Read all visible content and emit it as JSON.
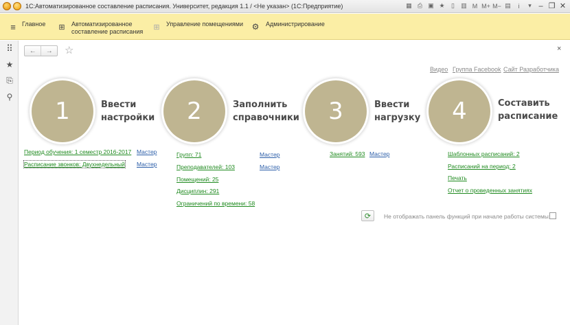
{
  "window": {
    "title": "1С:Автоматизированное составление расписания. Университет, редакция 1.1 / <Не указан>  (1С:Предприятие)",
    "title_icons": [
      "grid-icon",
      "printer-icon",
      "save-icon",
      "star-icon",
      "bookmark-icon",
      "calendar-icon",
      "m-icon",
      "m-plus-icon",
      "m-minus-icon",
      "panels-icon",
      "info-icon",
      "chevron-down-icon",
      "minimize-icon",
      "restore-icon",
      "close-icon"
    ],
    "title_glyphs": [
      "▦",
      "⎙",
      "▣",
      "★",
      "▯",
      "▥",
      "M",
      "M+",
      "M−",
      "▤",
      "i",
      "▾",
      "–",
      "❐",
      "✕"
    ]
  },
  "menu": {
    "items": [
      {
        "label_line1": "Главное",
        "label_line2": "",
        "icon": "hamburger-icon",
        "glyph": "≡"
      },
      {
        "label_line1": "Автоматизированное",
        "label_line2": "составление расписания",
        "icon": "grid-icon",
        "glyph": "⊞"
      },
      {
        "label_line1": "Управление помещениями",
        "label_line2": "",
        "icon": "grid-icon",
        "glyph": "⊞"
      },
      {
        "label_line1": "Администрирование",
        "label_line2": "",
        "icon": "gear-icon",
        "glyph": "⚙"
      }
    ]
  },
  "sidebar": {
    "items": [
      {
        "icon": "apps-grid-icon",
        "glyph": "⠿"
      },
      {
        "icon": "star-icon",
        "glyph": "★"
      },
      {
        "icon": "history-icon",
        "glyph": "⎘"
      },
      {
        "icon": "search-icon",
        "glyph": "⚲"
      }
    ]
  },
  "nav": {
    "back": "←",
    "forward": "→",
    "favorite": "☆",
    "close": "×"
  },
  "top_links": [
    "Видео",
    "Группа Facebook",
    "Сайт Разработчика"
  ],
  "steps": [
    {
      "number": "1",
      "title_line1": "Ввести",
      "title_line2": "настройки",
      "links": [
        {
          "text": "Период обучения: 1 семестр 2016-2017",
          "master": "Мастер"
        },
        {
          "text": "Расписание звонков: Двухнедельный",
          "master": "Мастер"
        }
      ]
    },
    {
      "number": "2",
      "title_line1": "Заполнить",
      "title_line2": "справочники",
      "links": [
        {
          "text": "Групп: 71",
          "master": "Мастер"
        },
        {
          "text": "Преподавателей: 103",
          "master": "Мастер"
        },
        {
          "text": "Помещений: 25",
          "master": ""
        },
        {
          "text": "Дисциплин: 291",
          "master": ""
        },
        {
          "text": "Ограничений по времени: 58",
          "master": ""
        }
      ]
    },
    {
      "number": "3",
      "title_line1": "Ввести",
      "title_line2": "нагрузку",
      "links": [
        {
          "text": "Занятий: 593",
          "master": "Мастер"
        }
      ]
    },
    {
      "number": "4",
      "title_line1": "Составить",
      "title_line2": "расписание",
      "links": [
        {
          "text": "Шаблонных расписаний: 2",
          "master": ""
        },
        {
          "text": "Расписаний на период: 2",
          "master": ""
        },
        {
          "text": "Печать",
          "master": ""
        },
        {
          "text": "Отчет о проведенных занятиях",
          "master": ""
        }
      ]
    }
  ],
  "footer": {
    "option_label": "Не отображать панель функций при начале работы системы:",
    "option_checked": false,
    "refresh_glyph": "⟳"
  },
  "colors": {
    "menu_bg": "#fbeea5",
    "circle": "#bfb591",
    "link_green": "#1f8a1f",
    "link_blue": "#2a5da8"
  }
}
